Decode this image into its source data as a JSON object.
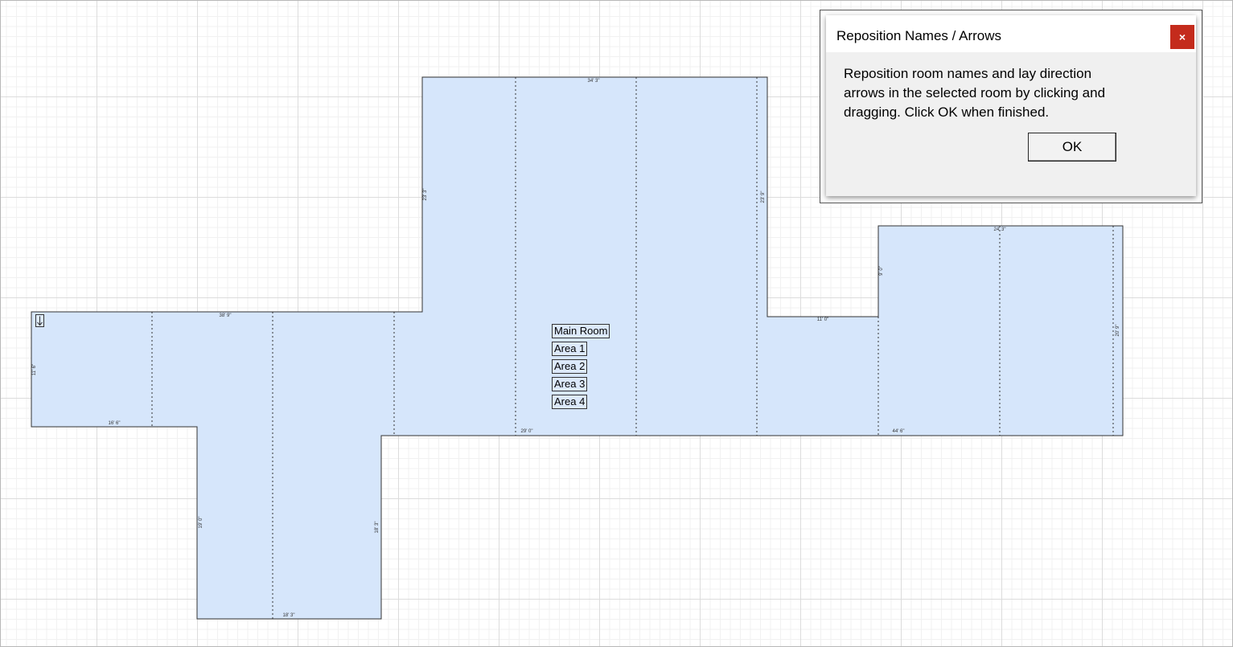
{
  "dialog": {
    "title": "Reposition Names / Arrows",
    "close_label": "×",
    "message": "Reposition room names and lay direction arrows in the selected room by clicking and dragging. Click OK when finished.",
    "ok_label": "OK"
  },
  "room": {
    "labels": [
      "Main Room",
      "Area 1",
      "Area 2",
      "Area 3",
      "Area 4"
    ],
    "dimensions": [
      "34' 3\"",
      "38' 9\"",
      "16' 6\"",
      "11' 6\"",
      "23' 3\"",
      "23' 9\"",
      "24' 3\"",
      "9' 0\"",
      "11' 0\"",
      "20' 9\"",
      "29' 0\"",
      "44' 6\"",
      "19' 0\"",
      "18' 3\"",
      "18' 3\""
    ],
    "direction_arrow": "↓"
  },
  "colors": {
    "room_fill": "#d6e6fb",
    "room_outline": "#333333",
    "close_button": "#c42b1c"
  }
}
